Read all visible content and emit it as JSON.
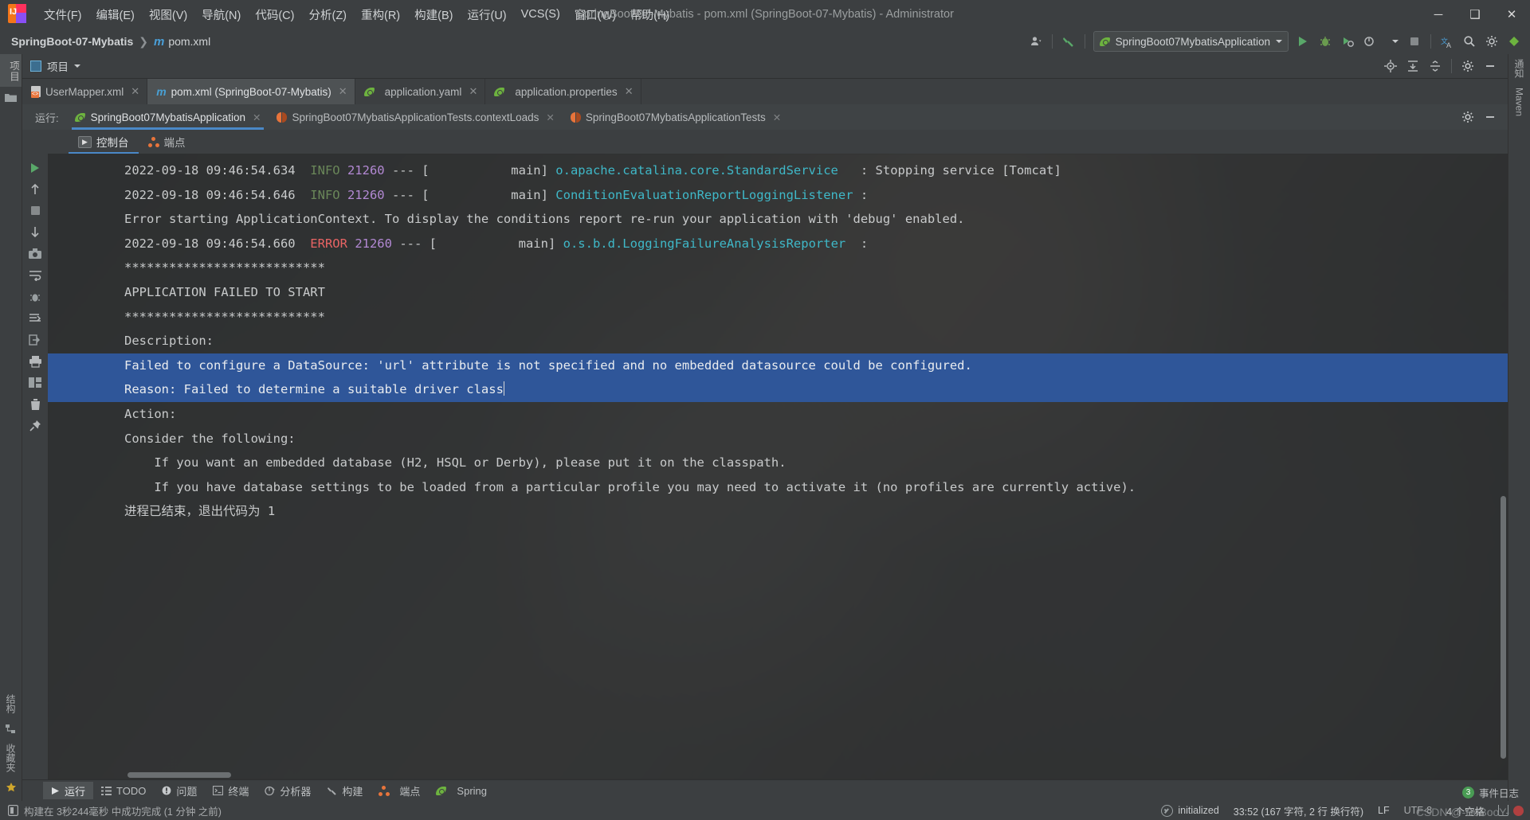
{
  "window": {
    "title": "SpringBoot-07-Mybatis - pom.xml (SpringBoot-07-Mybatis) - Administrator",
    "minimize": "─",
    "maximize": "❑",
    "close": "✕"
  },
  "menu": {
    "items": [
      {
        "label": "文件(F)"
      },
      {
        "label": "编辑(E)"
      },
      {
        "label": "视图(V)"
      },
      {
        "label": "导航(N)"
      },
      {
        "label": "代码(C)"
      },
      {
        "label": "分析(Z)"
      },
      {
        "label": "重构(R)"
      },
      {
        "label": "构建(B)"
      },
      {
        "label": "运行(U)"
      },
      {
        "label": "VCS(S)"
      },
      {
        "label": "窗口(W)"
      },
      {
        "label": "帮助(H)"
      }
    ]
  },
  "navbar": {
    "project": "SpringBoot-07-Mybatis",
    "separator": "❯",
    "file_icon": "m",
    "file": "pom.xml",
    "run_config": "SpringBoot07MybatisApplication",
    "run_config_icon": "spring-boot-icon"
  },
  "project_strip": {
    "label": "项目",
    "icons": [
      "locate-icon",
      "expand-all-icon",
      "collapse-all-icon",
      "gear-icon",
      "hide-icon"
    ]
  },
  "editor_tabs": [
    {
      "label": "UserMapper.xml",
      "icon": "xml-file-icon",
      "active": false,
      "close": "✕"
    },
    {
      "label": "pom.xml (SpringBoot-07-Mybatis)",
      "icon": "maven-icon",
      "active": true,
      "close": "✕"
    },
    {
      "label": "application.yaml",
      "icon": "spring-leaf-icon",
      "active": false,
      "close": "✕"
    },
    {
      "label": "application.properties",
      "icon": "spring-leaf-icon",
      "active": false,
      "close": "✕"
    }
  ],
  "run_window": {
    "label": "运行:",
    "tabs": [
      {
        "label": "SpringBoot07MybatisApplication",
        "icon": "spring-boot-icon",
        "active": true,
        "close": "✕"
      },
      {
        "label": "SpringBoot07MybatisApplicationTests.contextLoads",
        "icon": "junit-icon",
        "active": false,
        "close": "✕"
      },
      {
        "label": "SpringBoot07MybatisApplicationTests",
        "icon": "junit-icon",
        "active": false,
        "close": "✕"
      }
    ],
    "console_tabs": [
      {
        "label": "控制台",
        "icon": "console-icon",
        "active": true
      },
      {
        "label": "端点",
        "icon": "endpoint-icon",
        "active": false
      }
    ],
    "gutter_icons": [
      "rerun-icon",
      "scroll-up-icon",
      "scroll-down-icon",
      "soft-wrap-icon",
      "scroll-to-end-icon",
      "print-icon",
      "clear-all-icon"
    ]
  },
  "console": {
    "lines": [
      {
        "type": "log",
        "ts": "2022-09-18 09:46:54.634",
        "level": "INFO",
        "pid": "21260",
        "sep": " --- [",
        "thread": "           main] ",
        "logger": "o.apache.catalina.core.StandardService",
        "gap": "   ",
        "msg": ": Stopping service [Tomcat]"
      },
      {
        "type": "log",
        "ts": "2022-09-18 09:46:54.646",
        "level": "INFO",
        "pid": "21260",
        "sep": " --- [",
        "thread": "           main] ",
        "logger": "ConditionEvaluationReportLoggingListener",
        "gap": " ",
        "msg": ":"
      },
      {
        "type": "blank",
        "text": ""
      },
      {
        "type": "plain",
        "text": "Error starting ApplicationContext. To display the conditions report re-run your application with 'debug' enabled."
      },
      {
        "type": "log",
        "ts": "2022-09-18 09:46:54.660",
        "level": "ERROR",
        "pid": "21260",
        "sep": " --- [",
        "thread": "           main] ",
        "logger": "o.s.b.d.LoggingFailureAnalysisReporter",
        "gap": "  ",
        "msg": ":"
      },
      {
        "type": "blank",
        "text": ""
      },
      {
        "type": "plain",
        "text": "***************************"
      },
      {
        "type": "plain",
        "text": "APPLICATION FAILED TO START"
      },
      {
        "type": "plain",
        "text": "***************************"
      },
      {
        "type": "blank",
        "text": ""
      },
      {
        "type": "plain",
        "text": "Description:"
      },
      {
        "type": "blank",
        "text": ""
      },
      {
        "type": "selected",
        "text": "Failed to configure a DataSource: 'url' attribute is not specified and no embedded datasource could be configured."
      },
      {
        "type": "selected",
        "text": ""
      },
      {
        "type": "selected-caret",
        "text": "Reason: Failed to determine a suitable driver class"
      },
      {
        "type": "blank",
        "text": ""
      },
      {
        "type": "blank",
        "text": ""
      },
      {
        "type": "plain",
        "text": "Action:"
      },
      {
        "type": "blank",
        "text": ""
      },
      {
        "type": "plain",
        "text": "Consider the following:"
      },
      {
        "type": "plain",
        "text": "\tIf you want an embedded database (H2, HSQL or Derby), please put it on the classpath."
      },
      {
        "type": "plain",
        "text": "\tIf you have database settings to be loaded from a particular profile you may need to activate it (no profiles are currently active)."
      },
      {
        "type": "blank",
        "text": ""
      },
      {
        "type": "blank",
        "text": ""
      },
      {
        "type": "plain",
        "text": "进程已结束，退出代码为 1"
      }
    ]
  },
  "bottom_toolwindows": [
    {
      "label": "运行",
      "icon": "run-icon",
      "active": true
    },
    {
      "label": "TODO",
      "icon": "todo-icon",
      "active": false
    },
    {
      "label": "问题",
      "icon": "problems-icon",
      "active": false
    },
    {
      "label": "终端",
      "icon": "terminal-icon",
      "active": false
    },
    {
      "label": "分析器",
      "icon": "profiler-icon",
      "active": false
    },
    {
      "label": "构建",
      "icon": "build-icon",
      "active": false
    },
    {
      "label": "端点",
      "icon": "endpoint-icon",
      "active": false
    },
    {
      "label": "Spring",
      "icon": "spring-leaf-icon",
      "active": false
    }
  ],
  "left_rail": {
    "top_label": "项目",
    "bottom_labels": [
      "结构",
      "收藏夹"
    ]
  },
  "right_rail": {
    "labels": [
      "通知",
      "Maven"
    ]
  },
  "status": {
    "build_message": "构建在 3秒244毫秒 中成功完成 (1 分钟 之前)",
    "event_log": {
      "count": "3",
      "label": "事件日志"
    },
    "right_items": [
      {
        "name": "initialized",
        "label": "initialized"
      },
      {
        "name": "caret-position",
        "label": "33:52 (167 字符, 2 行 换行符)"
      },
      {
        "name": "line-separator",
        "label": "LF"
      },
      {
        "name": "encoding",
        "label": "UTF-8"
      },
      {
        "name": "indent",
        "label": "4 个空格"
      }
    ],
    "watermark": "CSDN @-BoBooY-"
  }
}
